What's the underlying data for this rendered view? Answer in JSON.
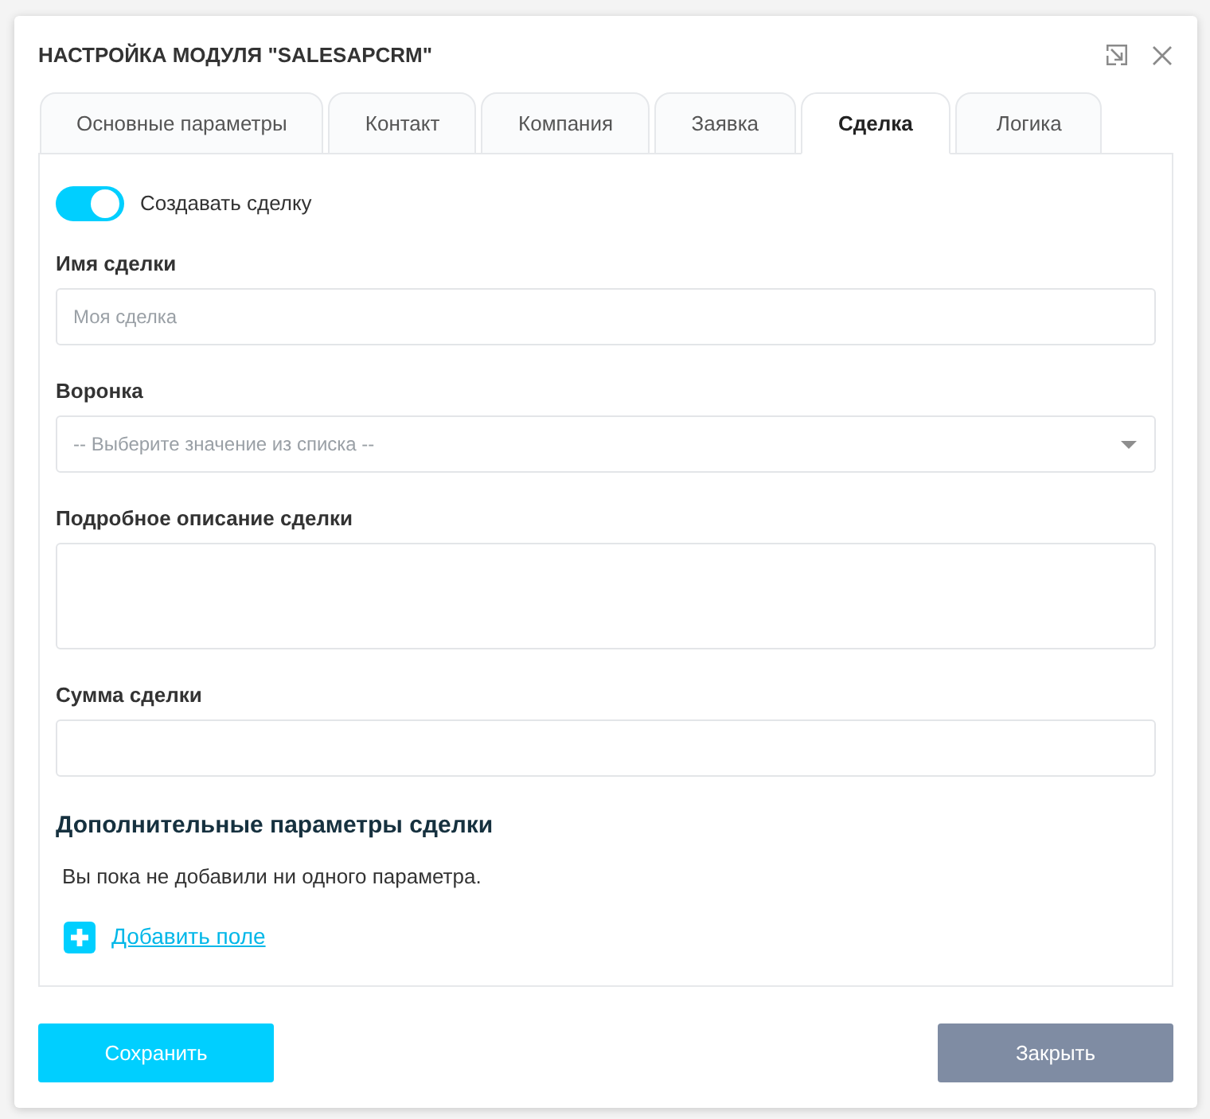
{
  "dialog": {
    "title": "НАСТРОЙКА МОДУЛЯ \"SALESAPCRM\"",
    "tabs": [
      {
        "label": "Основные параметры",
        "selected": false
      },
      {
        "label": "Контакт",
        "selected": false
      },
      {
        "label": "Компания",
        "selected": false
      },
      {
        "label": "Заявка",
        "selected": false
      },
      {
        "label": "Сделка",
        "selected": true
      },
      {
        "label": "Логика",
        "selected": false
      }
    ],
    "create_deal": {
      "label": "Создавать сделку",
      "on": true
    },
    "fields": [
      {
        "kind": "text",
        "label": "Имя сделки",
        "placeholder": "Моя сделка"
      },
      {
        "kind": "select",
        "label": "Воронка",
        "placeholder": "-- Выберите значение из списка --"
      },
      {
        "kind": "textarea",
        "label": "Подробное описание сделки"
      },
      {
        "kind": "text",
        "label": "Сумма сделки"
      }
    ],
    "extra": {
      "heading": "Дополнительные параметры сделки",
      "empty_message": "Вы пока не добавили ни одного параметра.",
      "add_link": "Добавить поле"
    },
    "buttons": [
      {
        "kind": "primary",
        "label": "Сохранить"
      },
      {
        "kind": "secondary",
        "label": "Закрыть"
      }
    ]
  }
}
